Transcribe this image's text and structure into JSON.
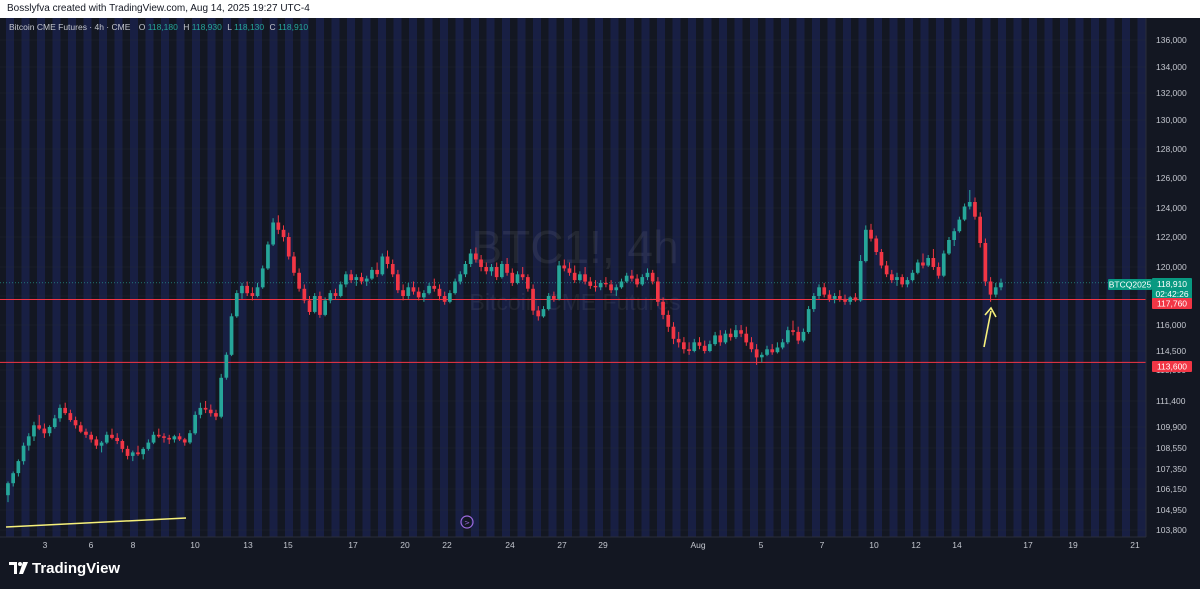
{
  "header": {
    "credit": "Bosslyfva created with TradingView.com, Aug 14, 2025 19:27 UTC-4"
  },
  "legend": {
    "title": "Bitcoin CME Futures · 4h · CME",
    "o_label": "O",
    "o_value": "118,180",
    "h_label": "H",
    "h_value": "118,930",
    "l_label": "L",
    "l_value": "118,130",
    "c_label": "C",
    "c_value": "118,910"
  },
  "watermark": {
    "symbol": "BTC1!, 4h",
    "name": "Bitcoin CME Futures"
  },
  "price_labels": {
    "ticker": "BTCQ2025",
    "last_price": "118,910",
    "countdown": "02:42:26",
    "line_upper": "117,760",
    "line_lower": "113,600"
  },
  "brand": {
    "name": "TradingView"
  },
  "colors": {
    "up": "#26a69a",
    "down": "#f23645",
    "background": "#131722",
    "session_band": "#1a2149",
    "level_line": "#f23645",
    "trendline": "#f6f07a",
    "arrow": "#f6f07a"
  },
  "chart_data": {
    "type": "candlestick",
    "y_axis": {
      "labels": [
        "136,000",
        "134,000",
        "132,000",
        "130,000",
        "128,000",
        "126,000",
        "124,000",
        "122,000",
        "120,000",
        "118,000",
        "116,000",
        "114,500",
        "113,000",
        "111,400",
        "109,900",
        "108,550",
        "107,350",
        "106,150",
        "104,950",
        "103,800"
      ],
      "ylim": [
        103700,
        137000
      ]
    },
    "x_axis": {
      "labels": [
        "3",
        "6",
        "8",
        "10",
        "13",
        "15",
        "17",
        "20",
        "22",
        "24",
        "27",
        "29",
        "Aug",
        "5",
        "7",
        "10",
        "12",
        "14",
        "17",
        "19",
        "21"
      ]
    },
    "last_close": 118910,
    "horizontal_levels": [
      117760,
      113600
    ],
    "candles": [
      [
        105800,
        106600,
        105400,
        106500
      ],
      [
        106500,
        107200,
        106300,
        107100
      ],
      [
        107100,
        107900,
        106900,
        107800
      ],
      [
        107800,
        108900,
        107600,
        108700
      ],
      [
        108700,
        109500,
        108400,
        109300
      ],
      [
        109300,
        110200,
        109000,
        110000
      ],
      [
        110000,
        110600,
        109700,
        109800
      ],
      [
        109800,
        110100,
        109200,
        109500
      ],
      [
        109500,
        110000,
        109300,
        109900
      ],
      [
        109900,
        110600,
        109800,
        110400
      ],
      [
        110400,
        111200,
        110200,
        111000
      ],
      [
        111000,
        111300,
        110600,
        110700
      ],
      [
        110700,
        110900,
        110200,
        110300
      ],
      [
        110300,
        110500,
        109800,
        110000
      ],
      [
        110000,
        110200,
        109500,
        109600
      ],
      [
        109600,
        109800,
        109200,
        109400
      ],
      [
        109400,
        109600,
        108900,
        109100
      ],
      [
        109100,
        109300,
        108500,
        108700
      ],
      [
        108700,
        109000,
        108300,
        108900
      ],
      [
        108900,
        109600,
        108800,
        109400
      ],
      [
        109400,
        109800,
        109100,
        109200
      ],
      [
        109200,
        109500,
        108800,
        109000
      ],
      [
        109000,
        109100,
        108300,
        108500
      ],
      [
        108500,
        108700,
        107900,
        108100
      ],
      [
        108100,
        108400,
        107800,
        108300
      ],
      [
        108300,
        108700,
        108100,
        108200
      ],
      [
        108200,
        108600,
        107900,
        108500
      ],
      [
        108500,
        109100,
        108400,
        108900
      ],
      [
        108900,
        109600,
        108800,
        109400
      ],
      [
        109400,
        109800,
        109200,
        109300
      ],
      [
        109300,
        109500,
        108900,
        109200
      ],
      [
        109200,
        109400,
        108800,
        109100
      ],
      [
        109100,
        109400,
        108900,
        109300
      ],
      [
        109300,
        109500,
        109000,
        109100
      ],
      [
        109100,
        109200,
        108700,
        108900
      ],
      [
        108900,
        109700,
        108800,
        109500
      ],
      [
        109500,
        110800,
        109400,
        110600
      ],
      [
        110600,
        111300,
        110400,
        111000
      ],
      [
        111000,
        111400,
        110700,
        110900
      ],
      [
        110900,
        111200,
        110500,
        110700
      ],
      [
        110700,
        110900,
        110300,
        110500
      ],
      [
        110500,
        112800,
        110400,
        112600
      ],
      [
        112600,
        114400,
        112500,
        114200
      ],
      [
        114200,
        116800,
        114100,
        116600
      ],
      [
        116600,
        118400,
        116500,
        118200
      ],
      [
        118200,
        118900,
        117800,
        118700
      ],
      [
        118700,
        119000,
        118000,
        118200
      ],
      [
        118200,
        118600,
        117700,
        118000
      ],
      [
        118000,
        118900,
        117900,
        118600
      ],
      [
        118600,
        120100,
        118500,
        119900
      ],
      [
        119900,
        121700,
        119800,
        121500
      ],
      [
        121500,
        123300,
        121400,
        123000
      ],
      [
        123000,
        123500,
        122200,
        122500
      ],
      [
        122500,
        122800,
        121700,
        122000
      ],
      [
        122000,
        122300,
        120500,
        120700
      ],
      [
        120700,
        121000,
        119400,
        119600
      ],
      [
        119600,
        119900,
        118300,
        118500
      ],
      [
        118500,
        118800,
        117500,
        117700
      ],
      [
        117700,
        118000,
        116700,
        116900
      ],
      [
        116900,
        118200,
        116800,
        118000
      ],
      [
        118000,
        118300,
        116500,
        116700
      ],
      [
        116700,
        117900,
        116600,
        117700
      ],
      [
        117700,
        118400,
        117500,
        118200
      ],
      [
        118200,
        118500,
        117800,
        118000
      ],
      [
        118000,
        119000,
        117900,
        118800
      ],
      [
        118800,
        119700,
        118600,
        119500
      ],
      [
        119500,
        119800,
        118900,
        119100
      ],
      [
        119100,
        119500,
        118700,
        119300
      ],
      [
        119300,
        119600,
        118800,
        119000
      ],
      [
        119000,
        119400,
        118700,
        119200
      ],
      [
        119200,
        120000,
        119100,
        119800
      ],
      [
        119800,
        120300,
        119300,
        119500
      ],
      [
        119500,
        120900,
        119400,
        120700
      ],
      [
        120700,
        121100,
        119900,
        120200
      ],
      [
        120200,
        120500,
        119300,
        119500
      ],
      [
        119500,
        119800,
        118200,
        118400
      ],
      [
        118400,
        118800,
        117700,
        118000
      ],
      [
        118000,
        118900,
        117800,
        118600
      ],
      [
        118600,
        119000,
        118100,
        118300
      ],
      [
        118300,
        118600,
        117700,
        117900
      ],
      [
        117900,
        118400,
        117600,
        118200
      ],
      [
        118200,
        118900,
        118100,
        118700
      ],
      [
        118700,
        119200,
        118300,
        118500
      ],
      [
        118500,
        118800,
        117700,
        118000
      ],
      [
        118000,
        118300,
        117400,
        117600
      ],
      [
        117600,
        118400,
        117500,
        118200
      ],
      [
        118200,
        119200,
        118100,
        119000
      ],
      [
        119000,
        119700,
        118800,
        119500
      ],
      [
        119500,
        120400,
        119300,
        120200
      ],
      [
        120200,
        121200,
        120000,
        120900
      ],
      [
        120900,
        121300,
        120300,
        120500
      ],
      [
        120500,
        120800,
        119700,
        120000
      ],
      [
        120000,
        120300,
        119500,
        119700
      ],
      [
        119700,
        120200,
        119400,
        120000
      ],
      [
        120000,
        120300,
        119100,
        119300
      ],
      [
        119300,
        120400,
        119200,
        120200
      ],
      [
        120200,
        120600,
        119400,
        119600
      ],
      [
        119600,
        119900,
        118700,
        118900
      ],
      [
        118900,
        119700,
        118800,
        119500
      ],
      [
        119500,
        120000,
        119100,
        119300
      ],
      [
        119300,
        119500,
        118300,
        118500
      ],
      [
        118500,
        118800,
        116700,
        117000
      ],
      [
        117000,
        117300,
        116300,
        116600
      ],
      [
        116600,
        117300,
        116500,
        117100
      ],
      [
        117100,
        118200,
        117000,
        118000
      ],
      [
        118000,
        118300,
        117600,
        117800
      ],
      [
        117800,
        120400,
        117700,
        120100
      ],
      [
        120100,
        120500,
        119700,
        119900
      ],
      [
        119900,
        120300,
        119400,
        119600
      ],
      [
        119600,
        120100,
        118900,
        119100
      ],
      [
        119100,
        119700,
        119000,
        119500
      ],
      [
        119500,
        120000,
        118800,
        119000
      ],
      [
        119000,
        119300,
        118500,
        118700
      ],
      [
        118700,
        119100,
        118300,
        118600
      ],
      [
        118600,
        119100,
        118400,
        118900
      ],
      [
        118900,
        119300,
        118600,
        118800
      ],
      [
        118800,
        119100,
        118200,
        118400
      ],
      [
        118400,
        118800,
        118000,
        118600
      ],
      [
        118600,
        119200,
        118500,
        119000
      ],
      [
        119000,
        119600,
        118900,
        119400
      ],
      [
        119400,
        119800,
        119000,
        119200
      ],
      [
        119200,
        119500,
        118600,
        118800
      ],
      [
        118800,
        119500,
        118700,
        119300
      ],
      [
        119300,
        119900,
        119100,
        119600
      ],
      [
        119600,
        119800,
        118800,
        119000
      ],
      [
        119000,
        119300,
        117300,
        117600
      ],
      [
        117600,
        117900,
        116400,
        116700
      ],
      [
        116700,
        117000,
        115600,
        115900
      ],
      [
        115900,
        116200,
        114900,
        115200
      ],
      [
        115200,
        115600,
        114700,
        115000
      ],
      [
        115000,
        115300,
        114300,
        114600
      ],
      [
        114600,
        115000,
        114200,
        114500
      ],
      [
        114500,
        115200,
        114400,
        115000
      ],
      [
        115000,
        115300,
        114600,
        114800
      ],
      [
        114800,
        115100,
        114300,
        114500
      ],
      [
        114500,
        115100,
        114400,
        114900
      ],
      [
        114900,
        115600,
        114800,
        115400
      ],
      [
        115400,
        115700,
        114800,
        115000
      ],
      [
        115000,
        115700,
        114900,
        115500
      ],
      [
        115500,
        115800,
        115100,
        115300
      ],
      [
        115300,
        116000,
        115200,
        115700
      ],
      [
        115700,
        116000,
        115300,
        115500
      ],
      [
        115500,
        115900,
        114800,
        115000
      ],
      [
        115000,
        115300,
        114400,
        114600
      ],
      [
        114600,
        114900,
        113400,
        114000
      ],
      [
        114000,
        114400,
        113600,
        114200
      ],
      [
        114200,
        114800,
        114100,
        114600
      ],
      [
        114600,
        114900,
        114200,
        114400
      ],
      [
        114400,
        115000,
        114300,
        114700
      ],
      [
        114700,
        115200,
        114600,
        115000
      ],
      [
        115000,
        115900,
        114900,
        115700
      ],
      [
        115700,
        116300,
        115400,
        115600
      ],
      [
        115600,
        115900,
        114900,
        115100
      ],
      [
        115100,
        115800,
        115000,
        115600
      ],
      [
        115600,
        117300,
        115500,
        117100
      ],
      [
        117100,
        118200,
        116900,
        118000
      ],
      [
        118000,
        118800,
        117800,
        118600
      ],
      [
        118600,
        118900,
        117900,
        118100
      ],
      [
        118100,
        118400,
        117600,
        117800
      ],
      [
        117800,
        118200,
        117500,
        118000
      ],
      [
        118000,
        118400,
        117600,
        117800
      ],
      [
        117800,
        118100,
        117400,
        117600
      ],
      [
        117600,
        118000,
        117400,
        117900
      ],
      [
        117900,
        118200,
        117600,
        117700
      ],
      [
        117700,
        120800,
        117600,
        120400
      ],
      [
        120400,
        122800,
        120300,
        122500
      ],
      [
        122500,
        122900,
        121700,
        121900
      ],
      [
        121900,
        122100,
        120800,
        121000
      ],
      [
        121000,
        121200,
        119900,
        120100
      ],
      [
        120100,
        120400,
        119300,
        119500
      ],
      [
        119500,
        119800,
        118900,
        119100
      ],
      [
        119100,
        119600,
        118700,
        119300
      ],
      [
        119300,
        119500,
        118600,
        118800
      ],
      [
        118800,
        119300,
        118600,
        119100
      ],
      [
        119100,
        119800,
        119000,
        119600
      ],
      [
        119600,
        120500,
        119500,
        120300
      ],
      [
        120300,
        120900,
        119900,
        120100
      ],
      [
        120100,
        120800,
        120000,
        120600
      ],
      [
        120600,
        121200,
        119800,
        120000
      ],
      [
        120000,
        120300,
        119200,
        119400
      ],
      [
        119400,
        121100,
        119300,
        120900
      ],
      [
        120900,
        122000,
        120800,
        121800
      ],
      [
        121800,
        122600,
        121400,
        122400
      ],
      [
        122400,
        123400,
        122300,
        123200
      ],
      [
        123200,
        124300,
        123100,
        124100
      ],
      [
        124100,
        125200,
        123900,
        124400
      ],
      [
        124400,
        124700,
        123200,
        123400
      ],
      [
        123400,
        123700,
        121300,
        121600
      ],
      [
        121600,
        121900,
        118700,
        119000
      ],
      [
        119000,
        119300,
        117600,
        118100
      ],
      [
        118100,
        118900,
        117900,
        118600
      ],
      [
        118600,
        119200,
        118400,
        118910
      ]
    ]
  }
}
